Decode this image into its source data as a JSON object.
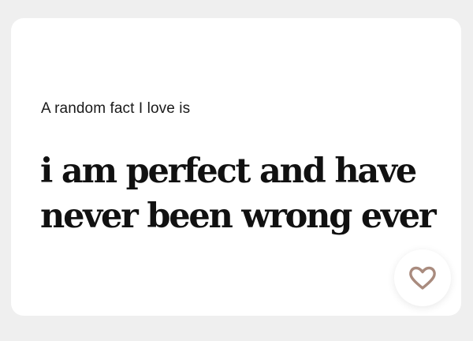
{
  "card": {
    "prompt": "A random fact I love is",
    "answer": "i am perfect and have never been wrong ever"
  },
  "like_button": {
    "icon": "heart-outline-icon",
    "icon_color": "#a98b7e"
  },
  "colors": {
    "background": "#efefef",
    "card": "#ffffff",
    "text": "#111111"
  }
}
